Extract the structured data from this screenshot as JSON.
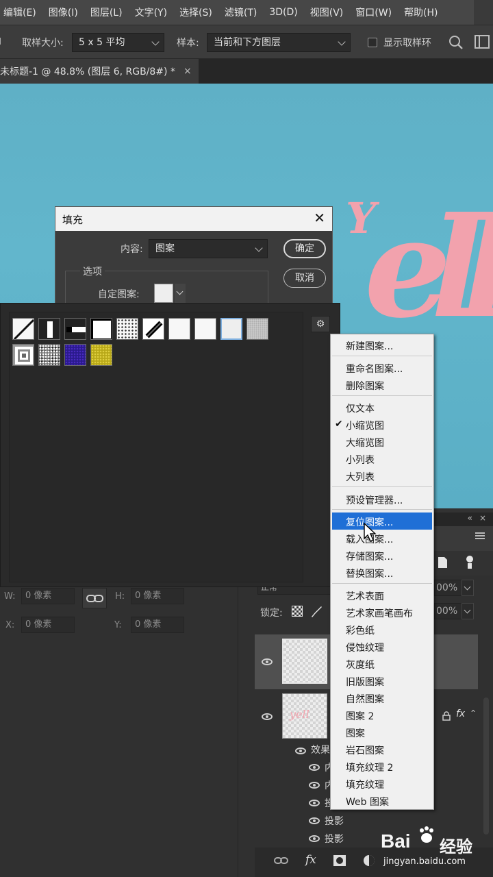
{
  "menubar": {
    "items": [
      "编辑(E)",
      "图像(I)",
      "图层(L)",
      "文字(Y)",
      "选择(S)",
      "滤镜(T)",
      "3D(D)",
      "视图(V)",
      "窗口(W)",
      "帮助(H)"
    ]
  },
  "options": {
    "sample_size_label": "取样大小:",
    "sample_size_value": "5 x 5 平均",
    "sample_label": "样本:",
    "sample_value": "当前和下方图层",
    "show_ring_label": "显示取样环"
  },
  "doc_tab": {
    "title": "未标题-1 @ 48.8% (图层 6, RGB/8#) *",
    "close": "×"
  },
  "canvas": {
    "art_text_1": "Y",
    "art_text_2": "ell"
  },
  "fill_dialog": {
    "title": "填充",
    "content_label": "内容:",
    "content_value": "图案",
    "options_label": "选项",
    "custom_pattern_label": "自定图案:",
    "ok": "确定",
    "cancel": "取消"
  },
  "pattern_picker": {
    "gear": "⚙",
    "patterns": [
      "diagonal-line",
      "vertical-bar",
      "horizontal-bar",
      "black-frame",
      "dots",
      "diagonal-stroke",
      "white-1",
      "white-2",
      "white-selected",
      "gray-noise",
      "concentric-squares",
      "black-noise",
      "blue-texture",
      "yellow-texture"
    ]
  },
  "flyout_menu": {
    "group1": [
      "新建图案..."
    ],
    "group2": [
      "重命名图案...",
      "删除图案"
    ],
    "group3": [
      "仅文本",
      "小缩览图",
      "大缩览图",
      "小列表",
      "大列表"
    ],
    "group4": [
      "预设管理器..."
    ],
    "group5": [
      "复位图案...",
      "载入图案...",
      "存储图案...",
      "替换图案..."
    ],
    "group6": [
      "艺术表面",
      "艺术家画笔画布",
      "彩色纸",
      "侵蚀纹理",
      "灰度纸",
      "旧版图案",
      "自然图案",
      "图案 2",
      "图案",
      "岩石图案",
      "填充纹理 2",
      "填充纹理",
      "Web 图案"
    ],
    "checked": "✔",
    "highlighted": "复位图案..."
  },
  "properties": {
    "w_label": "W:",
    "w_value": "0 像素",
    "h_label": "H:",
    "h_value": "0 像素",
    "x_label": "X:",
    "x_value": "0 像素",
    "y_label": "Y:",
    "y_value": "0 像素"
  },
  "layers": {
    "opacity_value": "00%",
    "fill_value": "00%",
    "lock_label": "锁定:",
    "blend_mode": "正常",
    "effects_label": "效果",
    "effect_rows": [
      "内",
      "内",
      "投",
      "投影",
      "投影"
    ],
    "fx": "fx",
    "thumb_text": "yell"
  },
  "watermark": {
    "brand": "Bai",
    "brand2": "经验",
    "url": "jingyan.baidu.com"
  }
}
